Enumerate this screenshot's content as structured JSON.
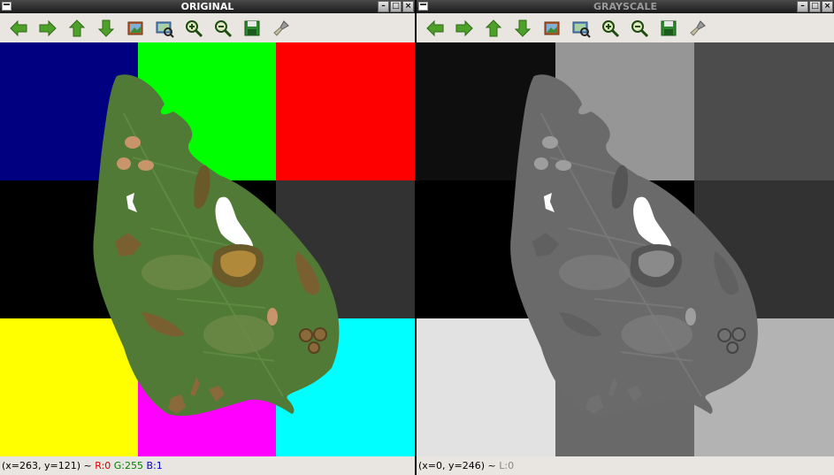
{
  "windows": {
    "original": {
      "title": "ORIGINAL",
      "status": {
        "coords": "(x=263, y=121) ~ ",
        "r": "R:0",
        "g": "G:255",
        "b": "B:1"
      }
    },
    "grayscale": {
      "title": "GRAYSCALE",
      "status": {
        "coords": "(x=0, y=246) ~ ",
        "l": "L:0"
      }
    }
  },
  "window_buttons": {
    "minimize": "–",
    "maximize": "□",
    "close": "×"
  },
  "toolbar_icons": [
    "arrow-left-icon",
    "arrow-right-icon",
    "arrow-up-icon",
    "arrow-down-icon",
    "save-image-icon",
    "zoom-fit-icon",
    "zoom-in-icon",
    "zoom-out-icon",
    "save-icon",
    "clear-brush-icon"
  ],
  "colors": {
    "blue": "#000080",
    "green": "#00ff00",
    "red": "#ff0000",
    "black": "#000000",
    "darkgray": "#323232",
    "yellow": "#ffff00",
    "magenta": "#ff00ff",
    "cyan": "#00ffff",
    "leaf": "#507a36",
    "gray_blue": "#0e0e0e",
    "gray_green": "#969696",
    "gray_red": "#4c4c4c",
    "gray_yellow": "#e2e2e2",
    "gray_magenta": "#696969",
    "gray_cyan": "#b3b3b3",
    "gray_leaf": "#6a6a6a"
  }
}
